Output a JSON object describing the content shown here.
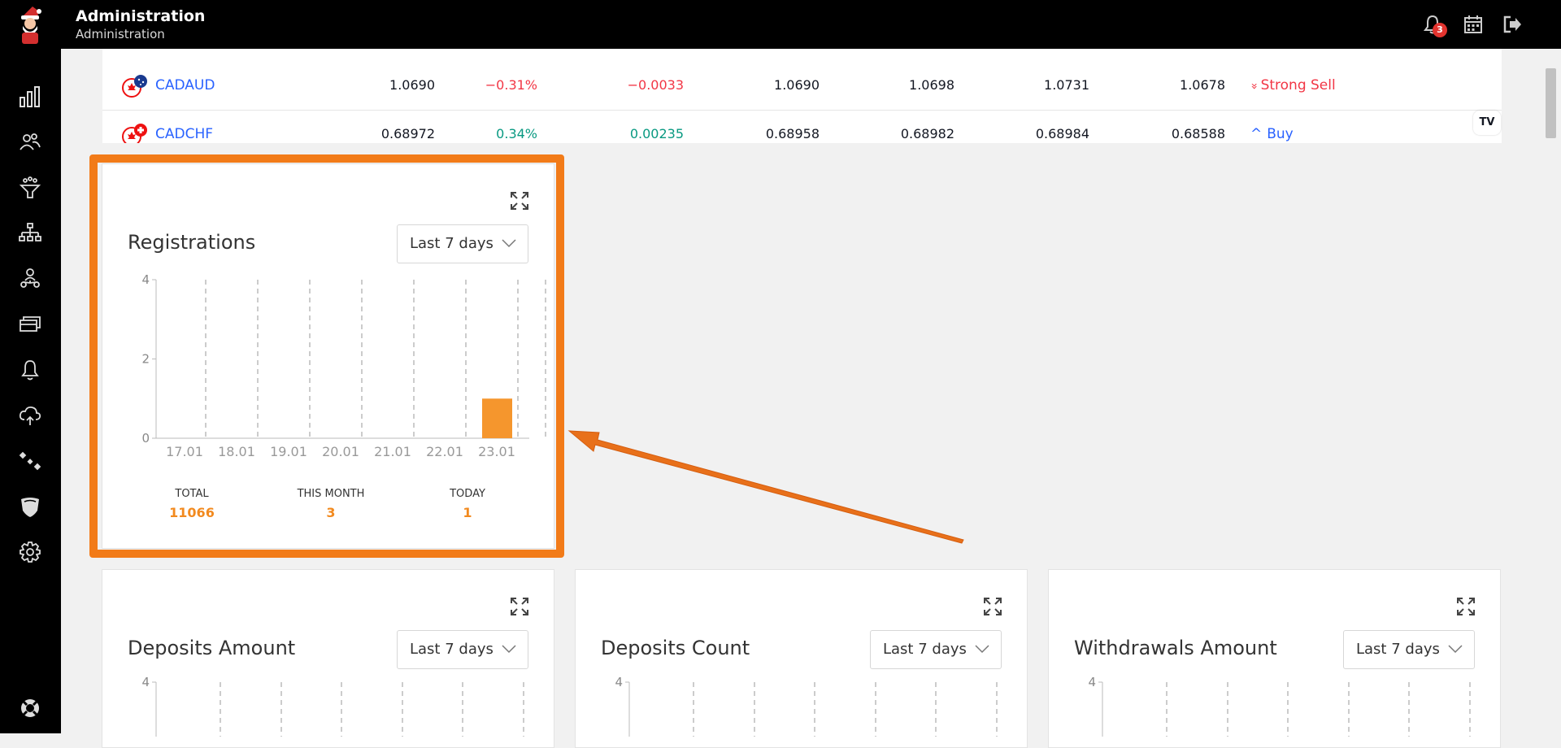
{
  "header": {
    "title": "Administration",
    "subtitle": "Administration",
    "notification_count": "3"
  },
  "sidebar": {
    "items": [
      {
        "name": "dashboard",
        "icon": "bar-chart-icon"
      },
      {
        "name": "users",
        "icon": "users-icon"
      },
      {
        "name": "filters",
        "icon": "funnel-icon"
      },
      {
        "name": "hierarchy",
        "icon": "org-chart-icon"
      },
      {
        "name": "affiliates",
        "icon": "network-icon"
      },
      {
        "name": "payments",
        "icon": "cards-icon"
      },
      {
        "name": "notifications",
        "icon": "bell-icon"
      },
      {
        "name": "sync",
        "icon": "cloud-sync-icon"
      },
      {
        "name": "integrations",
        "icon": "satellite-icon"
      },
      {
        "name": "security",
        "icon": "shield-icon"
      },
      {
        "name": "settings",
        "icon": "gear-icon"
      },
      {
        "name": "support",
        "icon": "lifebuoy-icon"
      }
    ]
  },
  "ticker": {
    "rows": [
      {
        "symbol": "CADAUD",
        "last": "1.0690",
        "change_pct": "−0.31%",
        "change": "−0.0033",
        "open": "1.0690",
        "bid": "1.0698",
        "high": "1.0731",
        "low": "1.0678",
        "rating": "Strong Sell",
        "rating_arrow": "»",
        "trend": "down"
      },
      {
        "symbol": "CADCHF",
        "last": "0.68972",
        "change_pct": "0.34%",
        "change": "0.00235",
        "open": "0.68958",
        "bid": "0.68982",
        "high": "0.68984",
        "low": "0.68588",
        "rating": "Buy",
        "rating_arrow": "^",
        "trend": "up"
      }
    ],
    "brand": "TV"
  },
  "widgets": {
    "registrations": {
      "title": "Registrations",
      "range": "Last 7 days",
      "stats": {
        "total_label": "TOTAL",
        "total_value": "11066",
        "month_label": "THIS MONTH",
        "month_value": "3",
        "today_label": "TODAY",
        "today_value": "1"
      }
    },
    "deposits_amount": {
      "title": "Deposits Amount",
      "range": "Last 7 days",
      "y_top": "4"
    },
    "deposits_count": {
      "title": "Deposits Count",
      "range": "Last 7 days",
      "y_top": "4"
    },
    "withdrawals_amount": {
      "title": "Withdrawals Amount",
      "range": "Last 7 days",
      "y_top": "4"
    }
  },
  "colors": {
    "accent": "#f28a1f",
    "highlight": "#f27b18",
    "bar": "#f5962d"
  },
  "chart_data": {
    "type": "bar",
    "categories": [
      "17.01",
      "18.01",
      "19.01",
      "20.01",
      "21.01",
      "22.01",
      "23.01"
    ],
    "values": [
      0,
      0,
      0,
      0,
      0,
      0,
      1
    ],
    "yticks": [
      "0",
      "2",
      "4"
    ],
    "ylim": [
      0,
      4
    ]
  }
}
